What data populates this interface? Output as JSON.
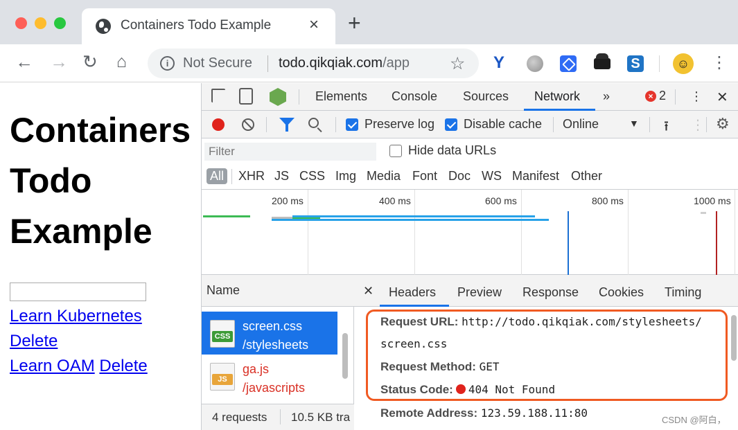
{
  "browser": {
    "tab_title": "Containers Todo Example",
    "tab_close": "×",
    "new_tab": "+",
    "security_label": "Not Secure",
    "url_host": "todo.qikqiak.com",
    "url_path": "/app"
  },
  "page": {
    "title": "Containers Todo Example",
    "links": [
      {
        "label": "Learn Kubernetes"
      },
      {
        "label": "Delete"
      },
      {
        "label": "Learn OAM"
      },
      {
        "label": "Delete"
      }
    ]
  },
  "devtools": {
    "tabs": [
      "Elements",
      "Console",
      "Sources",
      "Network"
    ],
    "more": "»",
    "active_tab": "Network",
    "error_count": "2",
    "toolbar": {
      "preserve_log": "Preserve log",
      "disable_cache": "Disable cache",
      "throttling": "Online"
    },
    "filter": {
      "placeholder": "Filter",
      "hide_data_urls": "Hide data URLs"
    },
    "types": [
      "All",
      "XHR",
      "JS",
      "CSS",
      "Img",
      "Media",
      "Font",
      "Doc",
      "WS",
      "Manifest",
      "Other"
    ],
    "timeline_ticks": [
      "200 ms",
      "400 ms",
      "600 ms",
      "800 ms",
      "1000 ms"
    ],
    "request_list": {
      "header": "Name",
      "rows": [
        {
          "name": "screen.css",
          "path": "/stylesheets",
          "badge": "CSS",
          "badge_color": "#3d9b37",
          "selected": true
        },
        {
          "name": "ga.js",
          "path": "/javascripts",
          "badge": "JS",
          "badge_color": "#e8a53a",
          "error": true
        }
      ],
      "footer_requests": "4 requests",
      "footer_size": "10.5 KB tra"
    },
    "detail": {
      "tabs": [
        "Headers",
        "Preview",
        "Response",
        "Cookies",
        "Timing"
      ],
      "active_tab": "Headers",
      "request_url_key": "Request URL:",
      "request_url_value": "http://todo.qikqiak.com/stylesheets/",
      "request_url_cont": "screen.css",
      "method_key": "Request Method:",
      "method_value": "GET",
      "status_key": "Status Code:",
      "status_value": "404 Not Found",
      "remote_key": "Remote Address:",
      "remote_value": "123.59.188.11:80"
    }
  },
  "watermark": "CSDN @阿白，"
}
